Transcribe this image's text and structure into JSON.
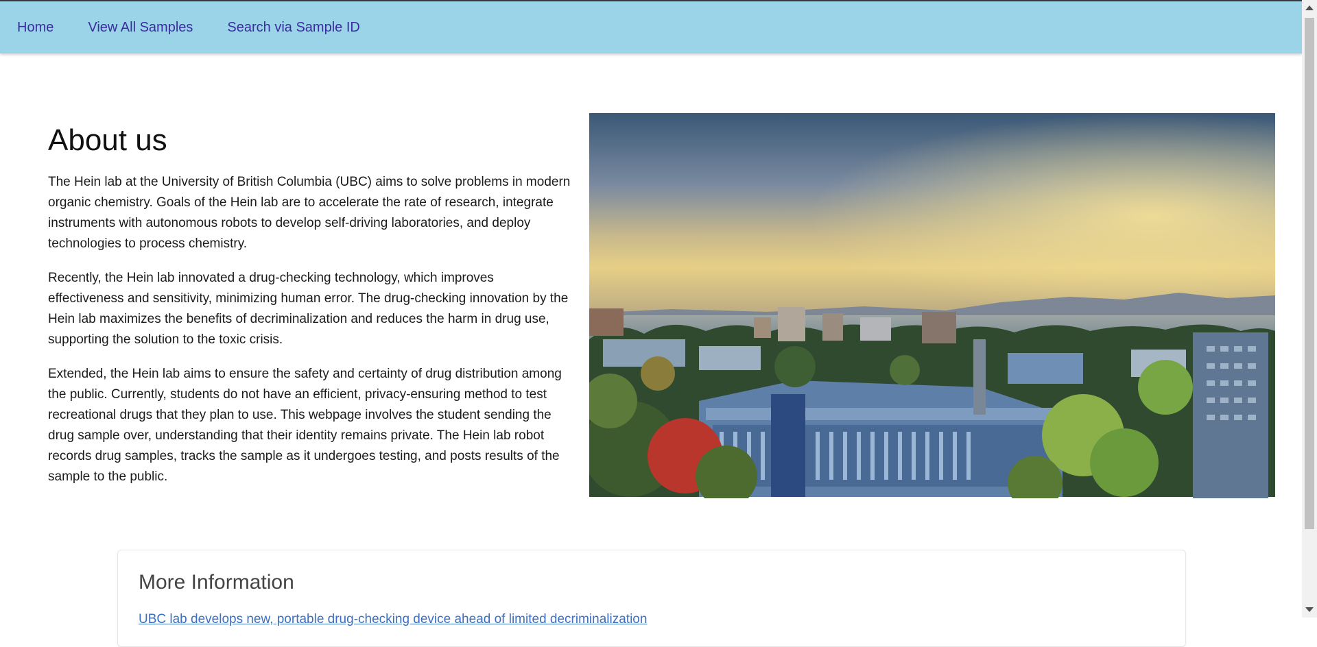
{
  "nav": {
    "home": "Home",
    "view_all": "View All Samples",
    "search": "Search via Sample ID"
  },
  "about": {
    "title": "About us",
    "p1": "The Hein lab at the University of British Columbia (UBC) aims to solve problems in modern organic chemistry. Goals of the Hein lab are to accelerate the rate of research, integrate instruments with autonomous robots to develop self-driving laboratories, and deploy technologies to process chemistry.",
    "p2": "Recently, the Hein lab innovated a drug-checking technology, which improves effectiveness and sensitivity, minimizing human error. The drug-checking innovation by the Hein lab maximizes the benefits of decriminalization and reduces the harm in drug use, supporting the solution to the toxic crisis.",
    "p3": "Extended, the Hein lab aims to ensure the safety and certainty of drug distribution among the public. Currently, students do not have an efficient, privacy-ensuring method to test recreational drugs that they plan to use. This webpage involves the student sending the drug sample over, understanding that their identity remains private. The Hein lab robot records drug samples, tracks the sample as it undergoes testing, and posts results of the sample to the public."
  },
  "more_info": {
    "title": "More Information",
    "link": "UBC lab develops new, portable drug-checking device ahead of limited decriminalization"
  },
  "colors": {
    "navbar": "#9bd3e9",
    "nav_link": "#3a2e9e",
    "link": "#3b6fc1"
  }
}
